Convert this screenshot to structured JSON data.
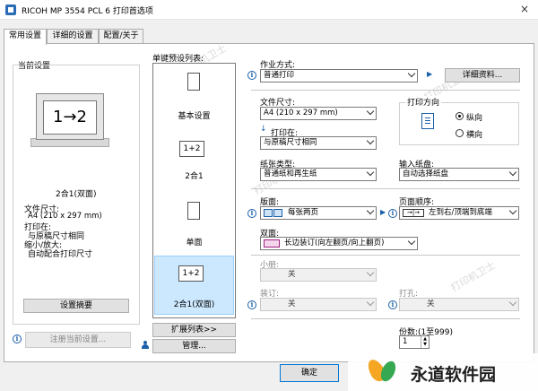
{
  "window": {
    "title": "RICOH MP 3554 PCL 6 打印首选项",
    "close": "×"
  },
  "tabs": [
    {
      "label": "常用设置"
    },
    {
      "label": "详细的设置"
    },
    {
      "label": "配置/关于"
    }
  ],
  "current_settings": {
    "heading": "当前设置",
    "preview_text": "1→2",
    "layout_label": "2合1(双面)",
    "paper_size_label": "文件尺寸:",
    "paper_size_value": "A4 (210 x 297 mm)",
    "print_on_label": "打印在:",
    "print_on_value": "与原稿尺寸相同",
    "zoom_label": "缩小/放大:",
    "zoom_value": "自动配合打印尺寸",
    "summary_button": "设置摘要",
    "register_button": "注册当前设置..."
  },
  "presets": {
    "heading": "单键预设列表:",
    "items": [
      {
        "label": "基本设置",
        "icon": "document-icon"
      },
      {
        "label": "2合1",
        "icon": "two-in-one-icon",
        "preview": "1+2"
      },
      {
        "label": "单面",
        "icon": "document-icon"
      },
      {
        "label": "2合1(双面)",
        "icon": "two-in-one-icon",
        "preview": "1+2"
      }
    ],
    "expand_button": "扩展列表>>",
    "manage_button": "管理..."
  },
  "job": {
    "label": "作业方式:",
    "value": "普通打印",
    "details_button": "详细资料..."
  },
  "document_size": {
    "label": "文件尺寸:",
    "value": "A4 (210 x 297 mm)"
  },
  "print_on": {
    "label": "打印在:",
    "value": "与原稿尺寸相同"
  },
  "orientation": {
    "label": "打印方向",
    "options": [
      "纵向",
      "横向"
    ],
    "selected": "纵向"
  },
  "paper_type": {
    "label": "纸张类型:",
    "value": "普通纸和再生纸"
  },
  "input_tray": {
    "label": "输入纸盘:",
    "value": "自动选择纸盘"
  },
  "layout": {
    "label": "版面:",
    "value": "每张两页"
  },
  "page_order": {
    "label": "页面顺序:",
    "value": "左到右/顶端到底端"
  },
  "duplex": {
    "label": "双面:",
    "value": "长边装订(向左翻页/向上翻页)"
  },
  "booklet": {
    "label": "小册:",
    "value": "关"
  },
  "staple": {
    "label": "装订:",
    "value": "关"
  },
  "punch": {
    "label": "打孔:",
    "value": "关"
  },
  "copies": {
    "label": "份数:(1至999)",
    "value": "1"
  },
  "footer": {
    "ok_button": "确定"
  },
  "watermark": {
    "text": "永道软件园",
    "faint_text": "打印机卫士"
  },
  "colors": {
    "accent": "#1a5fa8",
    "selection": "#cce8ff"
  }
}
